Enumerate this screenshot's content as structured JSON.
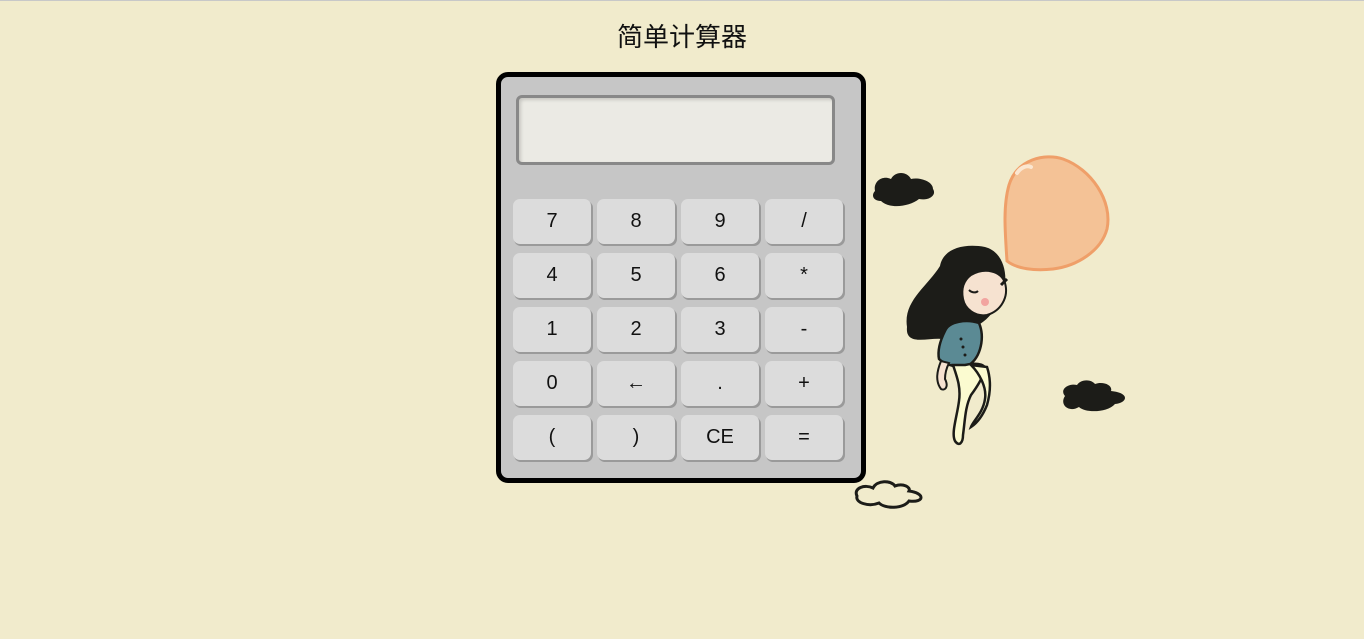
{
  "page": {
    "title": "简单计算器"
  },
  "calculator": {
    "display_value": "",
    "keys": [
      {
        "label": "7",
        "name": "key-7"
      },
      {
        "label": "8",
        "name": "key-8"
      },
      {
        "label": "9",
        "name": "key-9"
      },
      {
        "label": "/",
        "name": "key-divide"
      },
      {
        "label": "4",
        "name": "key-4"
      },
      {
        "label": "5",
        "name": "key-5"
      },
      {
        "label": "6",
        "name": "key-6"
      },
      {
        "label": "*",
        "name": "key-multiply"
      },
      {
        "label": "1",
        "name": "key-1"
      },
      {
        "label": "2",
        "name": "key-2"
      },
      {
        "label": "3",
        "name": "key-3"
      },
      {
        "label": "-",
        "name": "key-subtract"
      },
      {
        "label": "0",
        "name": "key-0"
      },
      {
        "label": "←",
        "name": "key-backspace"
      },
      {
        "label": ".",
        "name": "key-decimal"
      },
      {
        "label": "+",
        "name": "key-add"
      },
      {
        "label": "(",
        "name": "key-open-paren"
      },
      {
        "label": ")",
        "name": "key-close-paren"
      },
      {
        "label": "CE",
        "name": "key-clear"
      },
      {
        "label": "=",
        "name": "key-equals"
      }
    ]
  },
  "colors": {
    "background": "#f1ebcc",
    "calculator_body": "#c6c6c6",
    "key_face": "#dcdcdc",
    "display_bg": "#ebeae4",
    "balloon": "#f4c296"
  },
  "illustration": {
    "icon": "girl-with-bubblegum-balloon-and-clouds"
  }
}
